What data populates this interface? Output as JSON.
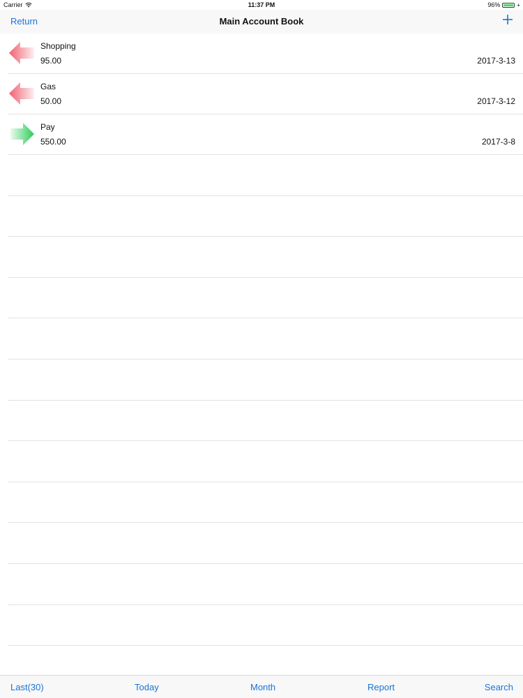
{
  "status_bar": {
    "carrier": "Carrier",
    "time": "11:37 PM",
    "battery": "96%",
    "battery_level": 0.96
  },
  "nav": {
    "return_label": "Return",
    "title": "Main Account Book",
    "add_icon": "plus-icon"
  },
  "entries": [
    {
      "title": "Shopping",
      "amount": "95.00",
      "date": "2017-3-13",
      "direction": "expense",
      "icon": "arrow-left-icon",
      "color": "#f06070"
    },
    {
      "title": "Gas",
      "amount": "50.00",
      "date": "2017-3-12",
      "direction": "expense",
      "icon": "arrow-left-icon",
      "color": "#f06070"
    },
    {
      "title": "Pay",
      "amount": "550.00",
      "date": "2017-3-8",
      "direction": "income",
      "icon": "arrow-right-icon",
      "color": "#2ecc5a"
    }
  ],
  "tabs": [
    {
      "label": "Last(30)"
    },
    {
      "label": "Today"
    },
    {
      "label": "Month"
    },
    {
      "label": "Report"
    },
    {
      "label": "Search"
    }
  ],
  "colors": {
    "accent": "#1a73d9",
    "expense": "#f06070",
    "income": "#2ecc5a",
    "bar_background": "#f8f8f8"
  }
}
